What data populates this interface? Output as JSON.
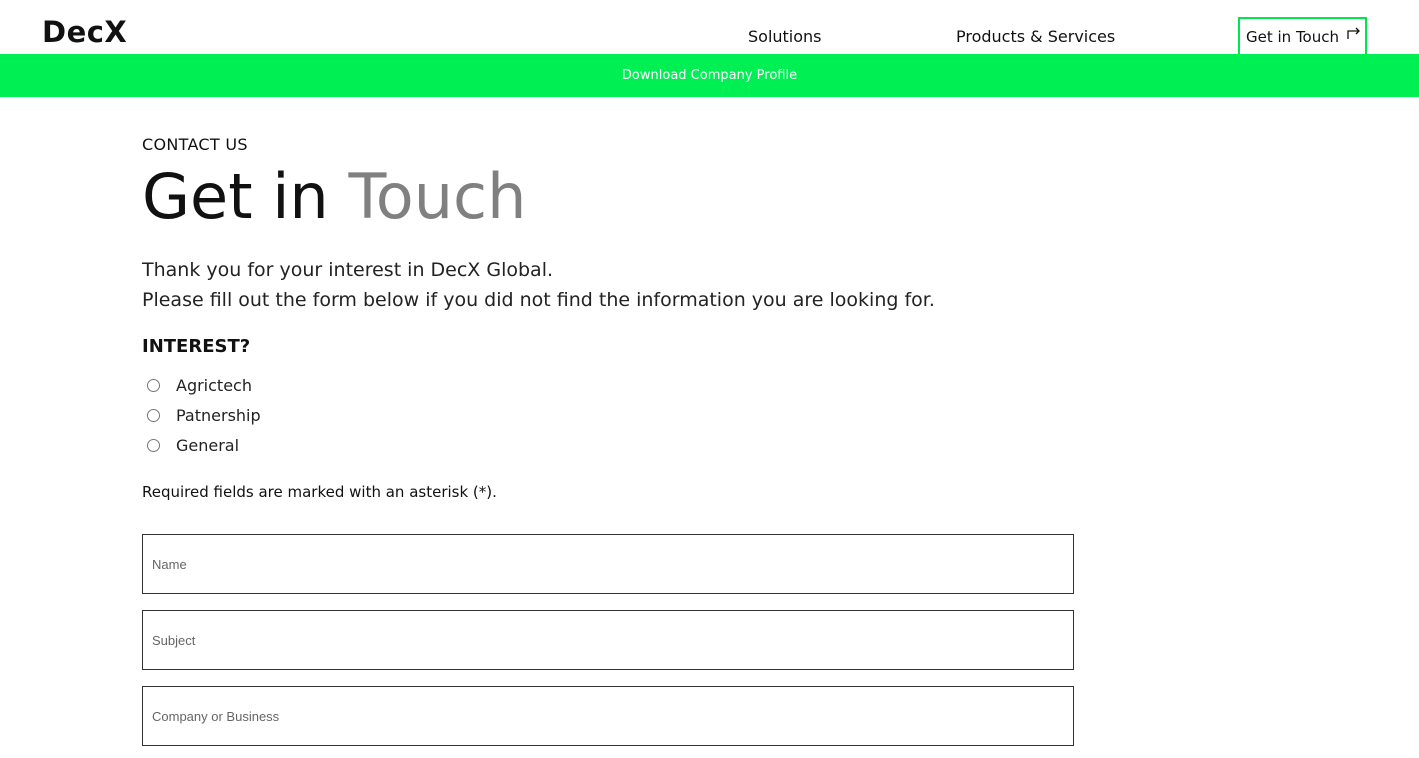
{
  "header": {
    "logo": "DecX",
    "nav": [
      {
        "label": "Solutions"
      },
      {
        "label": "Products & Services"
      }
    ],
    "cta_label": "Get in Touch",
    "cta_icon": "external-arrow-icon"
  },
  "banner": {
    "label": "Download Company Profile"
  },
  "main": {
    "eyebrow": "CONTACT US",
    "title_part1": "Get in",
    "title_part2": "Touch",
    "intro_line1": "Thank you for your interest in DecX Global.",
    "intro_line2": "Please fill out the form below if you did not find the information you are looking for.",
    "interest_label": "INTEREST?",
    "interest_options": [
      {
        "label": "Agrictech"
      },
      {
        "label": "Patnership"
      },
      {
        "label": "General"
      }
    ],
    "required_note": "Required fields are marked with an asterisk (*).",
    "fields": [
      {
        "placeholder": "Name"
      },
      {
        "placeholder": "Subject"
      },
      {
        "placeholder": "Company or Business"
      }
    ]
  },
  "colors": {
    "accent": "#00f053",
    "cta_border": "#00e64d",
    "muted_title": "#808080"
  }
}
